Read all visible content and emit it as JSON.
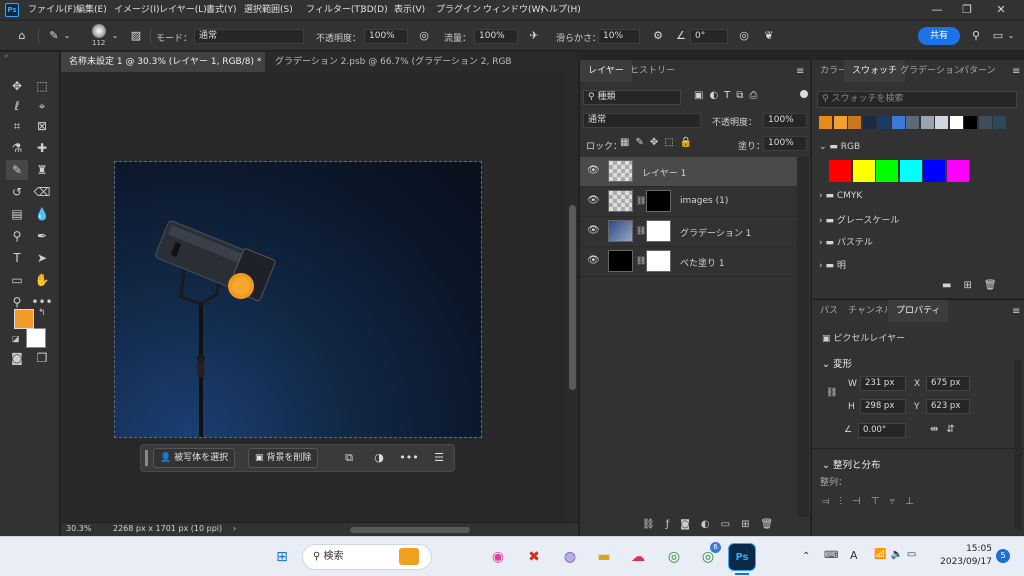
{
  "menu": [
    "ファイル(F)",
    "編集(E)",
    "イメージ(I)",
    "レイヤー(L)",
    "書式(Y)",
    "選択範囲(S)",
    "フィルター(T)",
    "3D(D)",
    "表示(V)",
    "プラグイン",
    "ウィンドウ(W)",
    "ヘルプ(H)"
  ],
  "app_logo": "Ps",
  "options": {
    "brush_size": "112",
    "mode_label": "モード：",
    "mode_value": "通常",
    "opacity_label": "不透明度：",
    "opacity_value": "100%",
    "flow_label": "流量：",
    "flow_value": "100%",
    "smooth_label": "滑らかさ：",
    "smooth_value": "10%",
    "angle_value": "0°",
    "share_label": "共有"
  },
  "doc_tabs": [
    {
      "label": "名称未設定 1 @ 30.3% (レイヤー 1, RGB/8) *",
      "close": "×"
    },
    {
      "label": "グラデーション 2.psb @ 66.7% (グラデーション 2, RGB/8) *",
      "close": "×"
    }
  ],
  "status": {
    "zoom": "30.3%",
    "doc_info": "2268 px x 1701 px (10 ppi)"
  },
  "context_bar": {
    "select_subject": "被写体を選択",
    "remove_bg": "背景を削除",
    "more": "•••"
  },
  "layers_panel": {
    "tabs": [
      "レイヤー",
      "ヒストリー"
    ],
    "filter_kind": "種類",
    "blend_mode": "通常",
    "opacity_label": "不透明度：",
    "opacity_value": "100%",
    "lock_label": "ロック：",
    "fill_label": "塗り：",
    "fill_value": "100%",
    "layers": [
      {
        "name": "レイヤー 1",
        "selected": true
      },
      {
        "name": "images (1)",
        "selected": false
      },
      {
        "name": "グラデーション 1",
        "selected": false
      },
      {
        "name": "べた塗り 1",
        "selected": false
      }
    ],
    "footer_icons": [
      "link-icon",
      "fx-icon",
      "mask-icon",
      "adjustment-icon",
      "folder-icon",
      "new-layer-icon",
      "trash-icon"
    ]
  },
  "swatches_panel": {
    "tabs": [
      "カラー",
      "スウォッチ",
      "グラデーション",
      "パターン"
    ],
    "search_placeholder": "スウォッチを検索",
    "recent_colors": [
      "#e8891c",
      "#f0a030",
      "#c8781e",
      "#1c2a44",
      "#1a3a6a",
      "#3a7ad8",
      "#5a6a7a",
      "#9aa4b0",
      "#d2d6dc",
      "#ffffff",
      "#000000",
      "#3c4e5a",
      "#2a4a5a"
    ],
    "groups": [
      {
        "name": "RGB",
        "colors": [
          "#ff0000",
          "#ffff00",
          "#00ff00",
          "#00ffff",
          "#0000ff",
          "#ff00ff"
        ]
      },
      {
        "name": "CMYK"
      },
      {
        "name": "グレースケール"
      },
      {
        "name": "パステル"
      },
      {
        "name": "明"
      }
    ]
  },
  "properties_panel": {
    "tabs": [
      "パス",
      "チャンネル",
      "プロパティ"
    ],
    "kind": "ピクセルレイヤー",
    "transform_label": "変形",
    "w_label": "W",
    "w_value": "231 px",
    "x_label": "X",
    "x_value": "675 px",
    "h_label": "H",
    "h_value": "298 px",
    "y_label": "Y",
    "y_value": "623 px",
    "angle_value": "0.00°",
    "align_label": "整列と分布",
    "align_sub": "整列："
  },
  "foreground_color": "#f09a2a",
  "background_color": "#ffffff",
  "taskbar": {
    "search_label": "検索",
    "time": "15:05",
    "date": "2023/09/17",
    "notif_count": "5",
    "chat_badge": "6",
    "ime": "A"
  }
}
